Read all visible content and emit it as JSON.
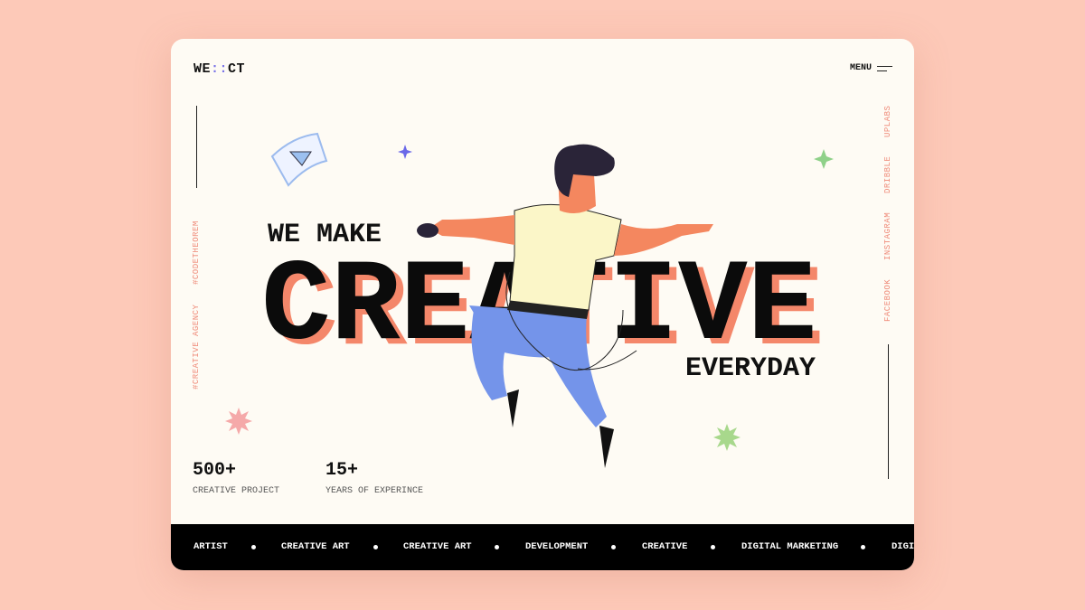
{
  "header": {
    "logo": {
      "left": "WE",
      "dots": "::",
      "right": "CT"
    },
    "menu_label": "MENU"
  },
  "left_tags": [
    "#CODETHEOREM",
    "#CREATIVE AGENCY"
  ],
  "social_links": [
    "UPLABS",
    "DRIBBLE",
    "INSTAGRAM",
    "FACEBOOK"
  ],
  "hero": {
    "line1": "WE MAKE",
    "headline": "CREATIVE",
    "line3": "EVERYDAY"
  },
  "stats": [
    {
      "value": "500+",
      "label": "CREATIVE PROJECT"
    },
    {
      "value": "15+",
      "label": "YEARS OF EXPERINCE"
    }
  ],
  "marquee": [
    "ARTIST",
    "CREATIVE ART",
    "CREATIVE ART",
    "DEVELOPMENT",
    "CREATIVE",
    "DIGITAL MARKETING",
    "DIGI"
  ],
  "colors": {
    "background": "#fdc9b8",
    "card": "#fefbf4",
    "accent": "#f4876a",
    "logo_dots": "#7b74e8",
    "tags": "#ef8a78",
    "bar": "#000000"
  }
}
